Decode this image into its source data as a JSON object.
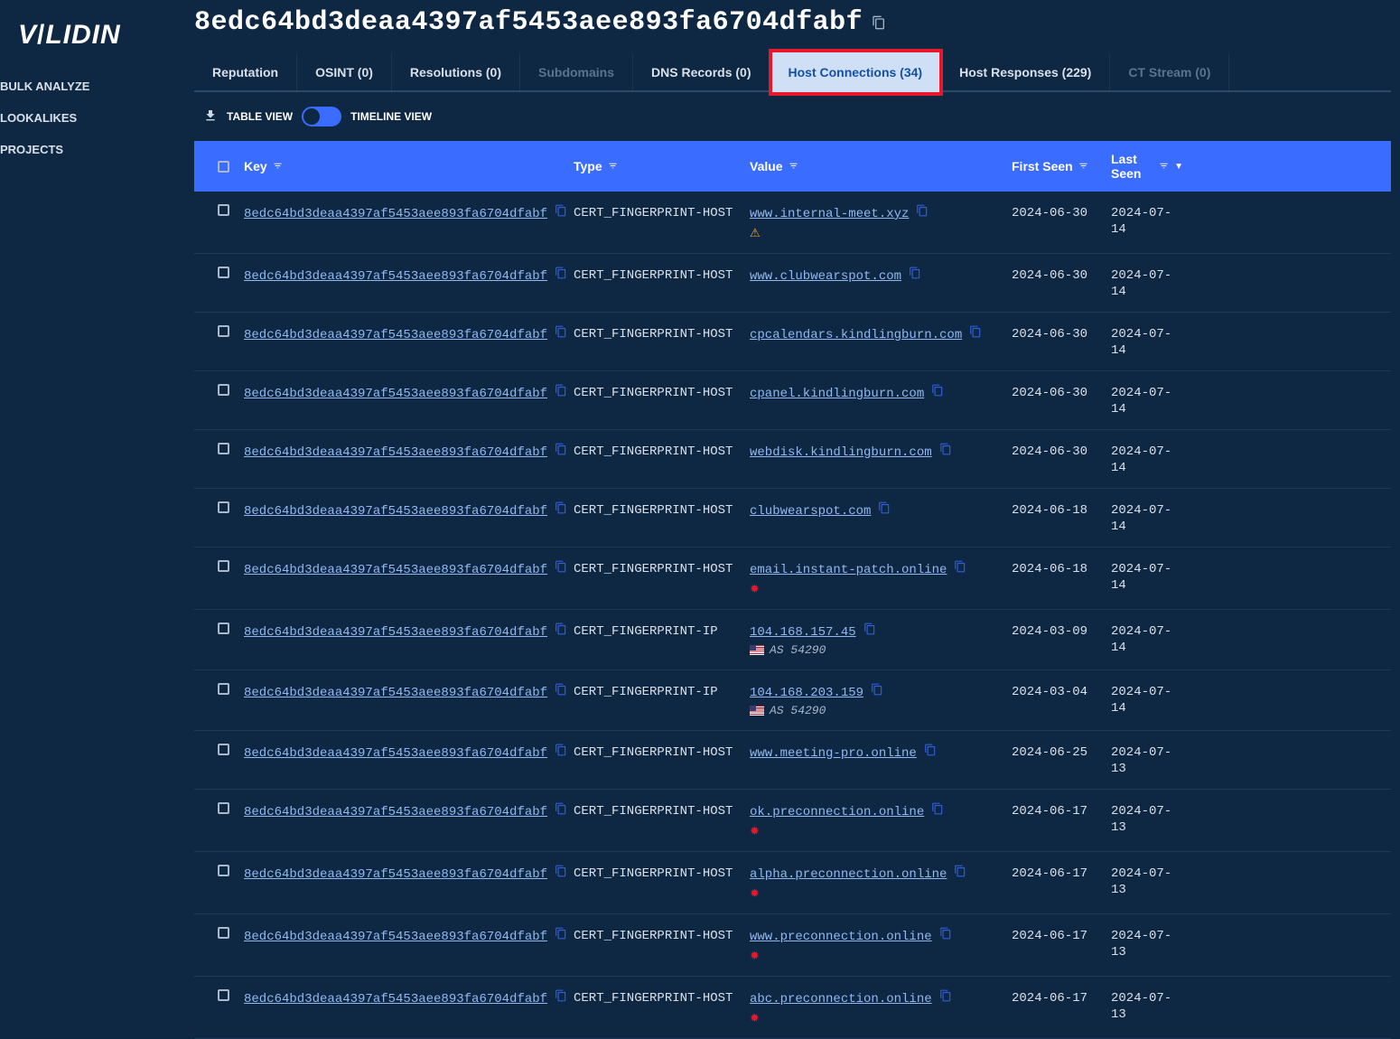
{
  "logo": "VALIDIN",
  "sidebar": {
    "items": [
      {
        "label": "BULK ANALYZE"
      },
      {
        "label": "LOOKALIKES"
      },
      {
        "label": "PROJECTS"
      }
    ]
  },
  "page_title": "8edc64bd3deaa4397af5453aee893fa6704dfabf",
  "tabs": [
    {
      "label": "Reputation",
      "state": "normal"
    },
    {
      "label": "OSINT (0)",
      "state": "normal"
    },
    {
      "label": "Resolutions (0)",
      "state": "normal"
    },
    {
      "label": "Subdomains",
      "state": "disabled"
    },
    {
      "label": "DNS Records (0)",
      "state": "normal"
    },
    {
      "label": "Host Connections (34)",
      "state": "active"
    },
    {
      "label": "Host Responses (229)",
      "state": "normal"
    },
    {
      "label": "CT Stream (0)",
      "state": "disabled"
    }
  ],
  "view": {
    "table_label": "TABLE VIEW",
    "timeline_label": "TIMELINE VIEW"
  },
  "columns": {
    "key": "Key",
    "type": "Type",
    "value": "Value",
    "first_seen": "First Seen",
    "last_seen": "Last Seen"
  },
  "key_hash": "8edc64bd3deaa4397af5453aee893fa6704dfabf",
  "rows": [
    {
      "type": "CERT_FINGERPRINT-HOST",
      "value": "www.internal-meet.xyz",
      "badge": "warn",
      "first": "2024-06-30",
      "last": "2024-07-14"
    },
    {
      "type": "CERT_FINGERPRINT-HOST",
      "value": "www.clubwearspot.com",
      "first": "2024-06-30",
      "last": "2024-07-14"
    },
    {
      "type": "CERT_FINGERPRINT-HOST",
      "value": "cpcalendars.kindlingburn.com",
      "first": "2024-06-30",
      "last": "2024-07-14"
    },
    {
      "type": "CERT_FINGERPRINT-HOST",
      "value": "cpanel.kindlingburn.com",
      "first": "2024-06-30",
      "last": "2024-07-14"
    },
    {
      "type": "CERT_FINGERPRINT-HOST",
      "value": "webdisk.kindlingburn.com",
      "first": "2024-06-30",
      "last": "2024-07-14"
    },
    {
      "type": "CERT_FINGERPRINT-HOST",
      "value": "clubwearspot.com",
      "first": "2024-06-18",
      "last": "2024-07-14"
    },
    {
      "type": "CERT_FINGERPRINT-HOST",
      "value": "email.instant-patch.online",
      "badge": "malware",
      "first": "2024-06-18",
      "last": "2024-07-14"
    },
    {
      "type": "CERT_FINGERPRINT-IP",
      "value": "104.168.157.45",
      "asn": "AS 54290",
      "flag": "us",
      "first": "2024-03-09",
      "last": "2024-07-14"
    },
    {
      "type": "CERT_FINGERPRINT-IP",
      "value": "104.168.203.159",
      "asn": "AS 54290",
      "flag": "us",
      "first": "2024-03-04",
      "last": "2024-07-14"
    },
    {
      "type": "CERT_FINGERPRINT-HOST",
      "value": "www.meeting-pro.online",
      "first": "2024-06-25",
      "last": "2024-07-13"
    },
    {
      "type": "CERT_FINGERPRINT-HOST",
      "value": "ok.preconnection.online",
      "badge": "malware",
      "first": "2024-06-17",
      "last": "2024-07-13"
    },
    {
      "type": "CERT_FINGERPRINT-HOST",
      "value": "alpha.preconnection.online",
      "badge": "malware",
      "first": "2024-06-17",
      "last": "2024-07-13"
    },
    {
      "type": "CERT_FINGERPRINT-HOST",
      "value": "www.preconnection.online",
      "badge": "malware",
      "first": "2024-06-17",
      "last": "2024-07-13"
    },
    {
      "type": "CERT_FINGERPRINT-HOST",
      "value": "abc.preconnection.online",
      "badge": "malware",
      "first": "2024-06-17",
      "last": "2024-07-13"
    }
  ]
}
